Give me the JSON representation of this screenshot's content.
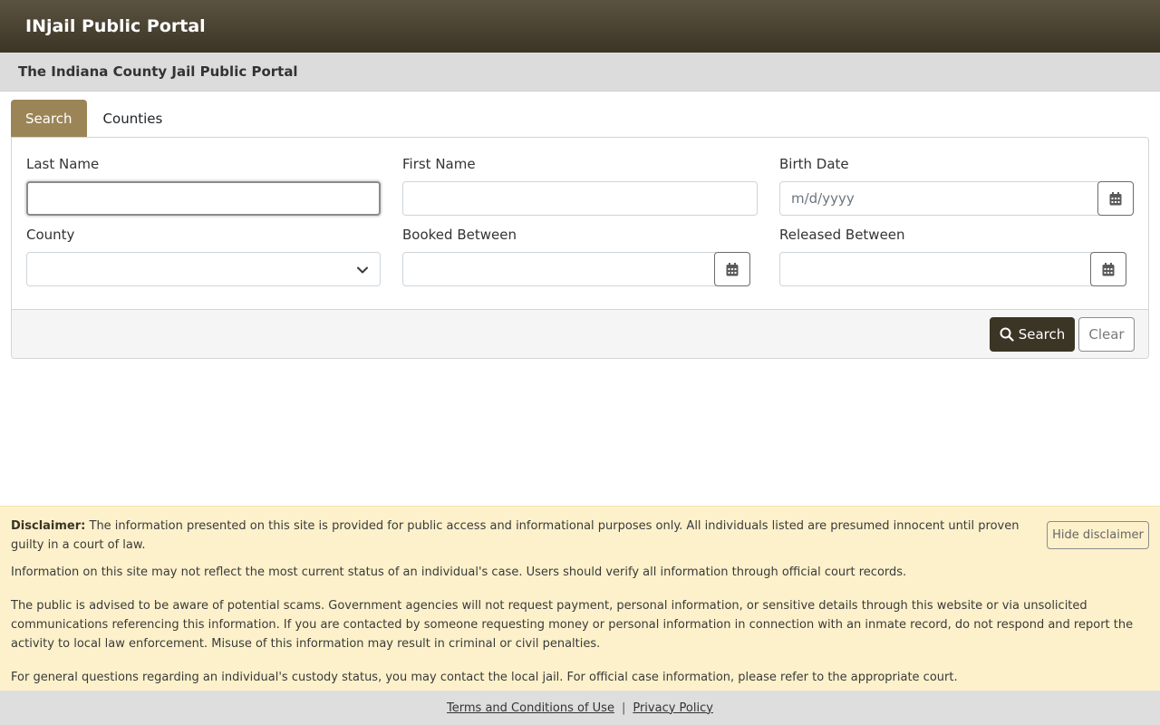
{
  "header": {
    "brand": "INjail Public Portal",
    "subtitle": "The Indiana County Jail Public Portal"
  },
  "tabs": [
    {
      "label": "Search",
      "active": true
    },
    {
      "label": "Counties",
      "active": false
    }
  ],
  "form": {
    "last_name": {
      "label": "Last Name",
      "value": "",
      "placeholder": ""
    },
    "first_name": {
      "label": "First Name",
      "value": "",
      "placeholder": ""
    },
    "birth_date": {
      "label": "Birth Date",
      "value": "",
      "placeholder": "m/d/yyyy"
    },
    "county": {
      "label": "County",
      "selected": ""
    },
    "booked_between": {
      "label": "Booked Between",
      "value": ""
    },
    "released_between": {
      "label": "Released Between",
      "value": ""
    }
  },
  "actions": {
    "search_label": "Search",
    "clear_label": "Clear"
  },
  "disclaimer": {
    "heading": "Disclaimer:",
    "p1": "The information presented on this site is provided for public access and informational purposes only. All individuals listed are presumed innocent until proven guilty in a court of law.",
    "p2": "Information on this site may not reflect the most current status of an individual's case. Users should verify all information through official court records.",
    "p3": "The public is advised to be aware of potential scams. Government agencies will not request payment, personal information, or sensitive details through this website or via unsolicited communications referencing this information. If you are contacted by someone requesting money or personal information in connection with an inmate record, do not respond and report the activity to local law enforcement. Misuse of this information may result in criminal or civil penalties.",
    "p4": "For general questions regarding an individual's custody status, you may contact the local jail. For official case information, please refer to the appropriate court.",
    "hide_label": "Hide disclaimer"
  },
  "footer": {
    "terms": "Terms and Conditions of Use",
    "separator": "|",
    "privacy": "Privacy Policy"
  },
  "colors": {
    "topbar": "#3b3526",
    "tab_active": "#9b8556",
    "search_button": "#3b3526",
    "disclaimer_bg": "#fdf1cb"
  },
  "icons": {
    "calendar": "calendar-icon",
    "search": "search-icon",
    "chevron": "chevron-down-icon"
  }
}
